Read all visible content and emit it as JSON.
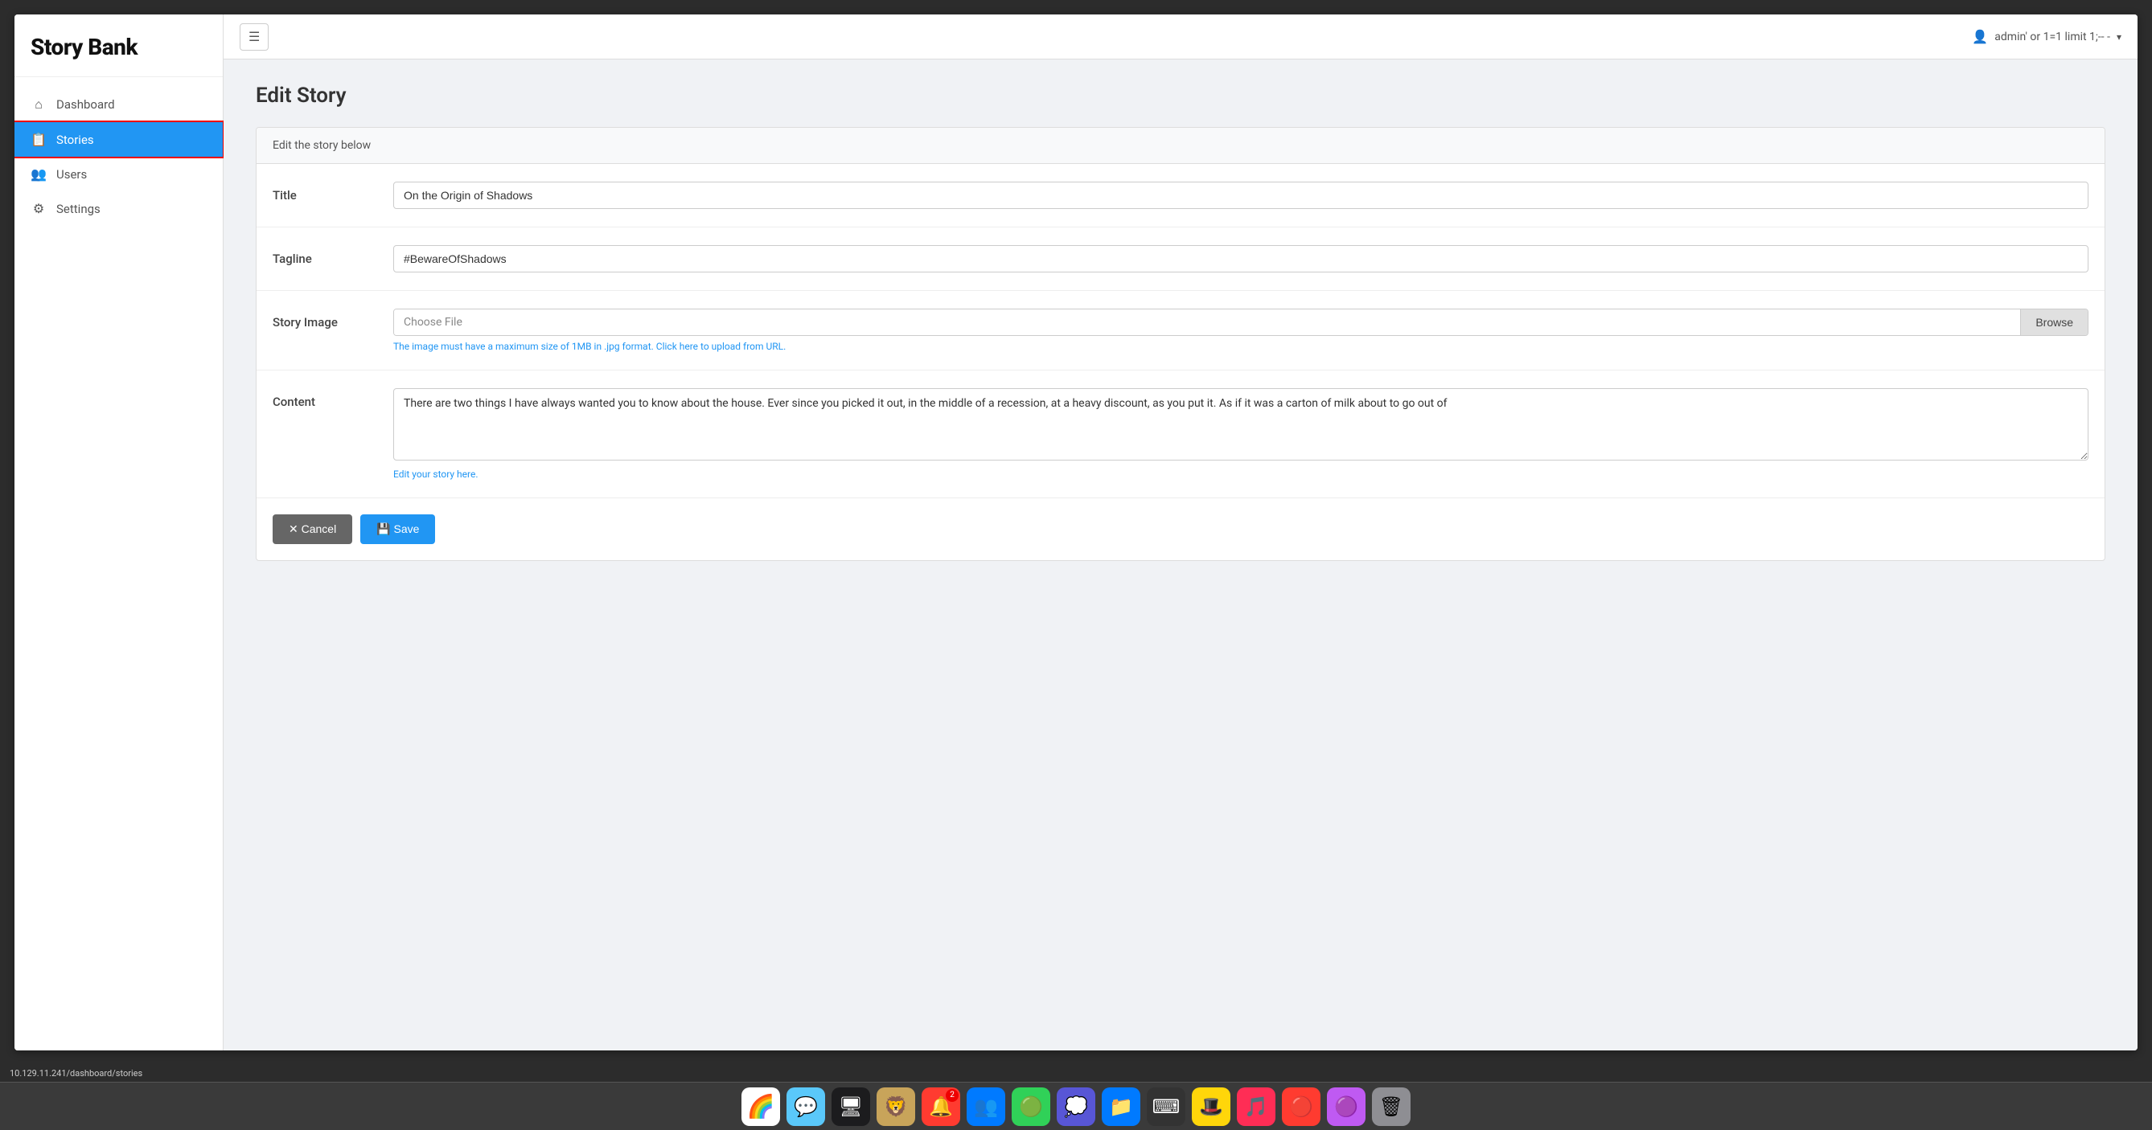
{
  "app": {
    "title": "Story Bank"
  },
  "topbar": {
    "hamburger_label": "☰",
    "user_label": "admin' or 1=1 limit 1;-- -",
    "dropdown_arrow": "▾"
  },
  "sidebar": {
    "items": [
      {
        "id": "dashboard",
        "label": "Dashboard",
        "icon": "⌂",
        "active": false
      },
      {
        "id": "stories",
        "label": "Stories",
        "icon": "📋",
        "active": true
      },
      {
        "id": "users",
        "label": "Users",
        "icon": "👥",
        "active": false
      },
      {
        "id": "settings",
        "label": "Settings",
        "icon": "⚙",
        "active": false
      }
    ]
  },
  "page": {
    "title": "Edit Story",
    "form_header": "Edit the story below",
    "fields": {
      "title": {
        "label": "Title",
        "value": "On the Origin of Shadows"
      },
      "tagline": {
        "label": "Tagline",
        "value": "#BewareOfShadows"
      },
      "story_image": {
        "label": "Story Image",
        "placeholder": "Choose File",
        "browse_label": "Browse",
        "hint": "The image must have a maximum size of 1MB in .jpg format. Click here to upload from URL."
      },
      "content": {
        "label": "Content",
        "value": "There are two things I have always wanted you to know about the house. Ever since you picked it out, in the middle of a recession, at a heavy discount, as you put it. As if it was a carton of milk about to go out of",
        "placeholder": "Edit your story here."
      }
    },
    "buttons": {
      "cancel_label": "✕ Cancel",
      "save_label": "💾 Save"
    }
  },
  "statusbar": {
    "url": "10.129.11.241/dashboard/stories"
  },
  "taskbar": {
    "icons": [
      {
        "id": "finder",
        "emoji": "🌈",
        "bg": "#fff"
      },
      {
        "id": "messages",
        "emoji": "💬",
        "bg": "#5ac8fa",
        "badge": null
      },
      {
        "id": "monitor",
        "emoji": "🖥",
        "bg": "#1c1c1e"
      },
      {
        "id": "animal",
        "emoji": "🦁",
        "bg": "#c8a45a"
      },
      {
        "id": "notif",
        "emoji": "🔔",
        "bg": "#ff3b30",
        "badge": "2"
      },
      {
        "id": "team",
        "emoji": "👥",
        "bg": "#007aff"
      },
      {
        "id": "circle",
        "emoji": "🟢",
        "bg": "#30d158"
      },
      {
        "id": "chat2",
        "emoji": "💭",
        "bg": "#5856d6"
      },
      {
        "id": "folder",
        "emoji": "📁",
        "bg": "#007aff"
      },
      {
        "id": "code",
        "emoji": "⌨",
        "bg": "#333"
      },
      {
        "id": "hat",
        "emoji": "🎩",
        "bg": "#ffd60a"
      },
      {
        "id": "music",
        "emoji": "🎵",
        "bg": "#ff2d55"
      },
      {
        "id": "red2",
        "emoji": "🔴",
        "bg": "#ff3b30"
      },
      {
        "id": "purple",
        "emoji": "🟣",
        "bg": "#bf5af2"
      },
      {
        "id": "trash",
        "emoji": "🗑",
        "bg": "#8e8e93"
      }
    ]
  }
}
